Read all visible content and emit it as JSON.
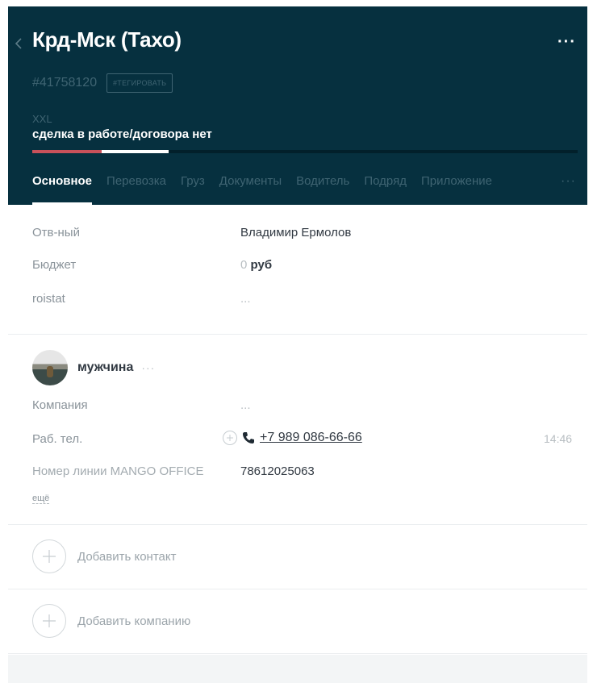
{
  "header": {
    "title": "Крд-Мск (Тахо)",
    "more_label": "···",
    "deal_id": "#41758120",
    "tag_button": "#ТЕГИРОВАТЬ",
    "pipeline": "XXL",
    "status": "сделка в работе/договора нет",
    "progress_fraction": 0.25
  },
  "tabs": {
    "items": [
      {
        "label": "Основное",
        "active": true
      },
      {
        "label": "Перевозка"
      },
      {
        "label": "Груз"
      },
      {
        "label": "Документы"
      },
      {
        "label": "Водитель"
      },
      {
        "label": "Подряд"
      },
      {
        "label": "Приложение"
      }
    ],
    "more_label": "···"
  },
  "fields": {
    "responsible": {
      "label": "Отв-ный",
      "value": "Владимир Ермолов"
    },
    "budget": {
      "label": "Бюджет",
      "amount": "0",
      "currency": "руб"
    },
    "roistat": {
      "label": "roistat",
      "value": "..."
    }
  },
  "contact": {
    "name": "мужчина",
    "more": "···",
    "company_label": "Компания",
    "company_value": "...",
    "phone_label": "Раб. тел.",
    "phone": "+7 989 086-66-66",
    "phone_time": "14:46",
    "mango_label": "Номер линии MANGO OFFICE",
    "mango_value": "78612025063",
    "more_link": "ещё"
  },
  "actions": {
    "add_contact": "Добавить контакт",
    "add_company": "Добавить компанию"
  },
  "colors": {
    "header_bg": "#06303f",
    "accent_red": "#c8515a"
  }
}
